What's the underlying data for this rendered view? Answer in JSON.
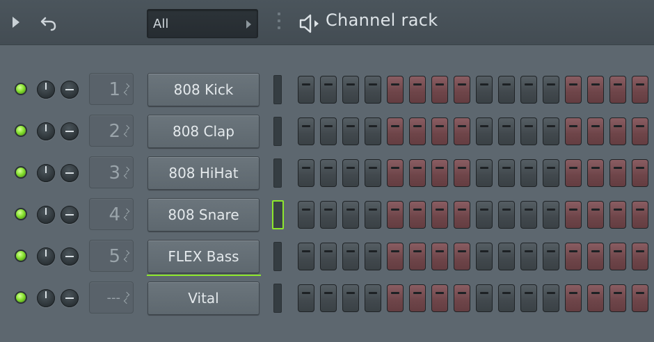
{
  "header": {
    "filter_value": "All",
    "title": "Channel rack",
    "icons": [
      "play-arrow-icon",
      "undo-icon",
      "grip-icon",
      "speaker-icon"
    ]
  },
  "channels": [
    {
      "number": "1",
      "name": "808 Kick",
      "mixer_active": false,
      "selected": false
    },
    {
      "number": "2",
      "name": "808 Clap",
      "mixer_active": false,
      "selected": false
    },
    {
      "number": "3",
      "name": "808 HiHat",
      "mixer_active": false,
      "selected": false
    },
    {
      "number": "4",
      "name": "808 Snare",
      "mixer_active": true,
      "selected": false
    },
    {
      "number": "5",
      "name": "FLEX Bass",
      "mixer_active": false,
      "selected": true
    },
    {
      "number": "---",
      "name": "Vital",
      "mixer_active": false,
      "selected": false
    }
  ],
  "step_groups": [
    "grey",
    "grey",
    "grey",
    "grey",
    "red",
    "red",
    "red",
    "red",
    "grey",
    "grey",
    "grey",
    "grey",
    "red",
    "red",
    "red",
    "red"
  ],
  "colors": {
    "led_green": "#86e12f",
    "select_accent": "#8ee82d",
    "step_grey": "#41484d",
    "step_red": "#6e4549",
    "background": "#5d676f"
  }
}
